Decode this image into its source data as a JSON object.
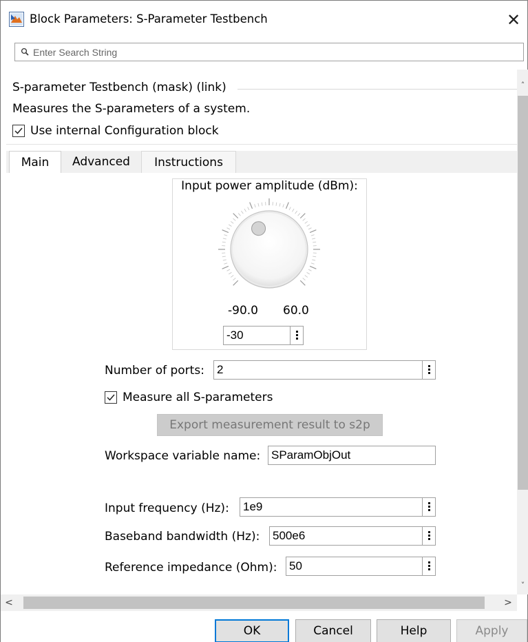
{
  "window": {
    "title": "Block Parameters: S-Parameter Testbench",
    "close_glyph": "✕"
  },
  "search": {
    "placeholder": "Enter Search String",
    "icon": "magnifier-icon"
  },
  "mask": {
    "title": "S-parameter Testbench (mask) (link)",
    "description": "Measures the S-parameters of a system.",
    "use_internal_config_label": "Use internal Configuration block",
    "use_internal_config_checked": true
  },
  "tabs": [
    {
      "label": "Main",
      "active": true
    },
    {
      "label": "Advanced",
      "active": false
    },
    {
      "label": "Instructions",
      "active": false
    }
  ],
  "knob": {
    "label": "Input power amplitude (dBm):",
    "min": "-90.0",
    "max": "60.0",
    "value": "-30"
  },
  "params": {
    "num_ports_label": "Number of ports:",
    "num_ports_value": "2",
    "measure_all_label": "Measure all S-parameters",
    "measure_all_checked": true,
    "export_label": "Export measurement result to s2p",
    "workspace_label": "Workspace variable name:",
    "workspace_value": "SParamObjOut",
    "input_freq_label": "Input frequency (Hz):",
    "input_freq_value": "1e9",
    "baseband_label": "Baseband bandwidth (Hz):",
    "baseband_value": "500e6",
    "ref_imp_label": "Reference impedance (Ohm):",
    "ref_imp_value": "50"
  },
  "scrollbars": {
    "up": "˄",
    "down": "˅",
    "left": "<",
    "right": ">"
  },
  "buttons": {
    "ok": "OK",
    "cancel": "Cancel",
    "help": "Help",
    "apply": "Apply"
  },
  "colors": {
    "accent": "#0078d7",
    "disabled_button": "#cccccc",
    "scroll_thumb": "#c2c2c2"
  }
}
